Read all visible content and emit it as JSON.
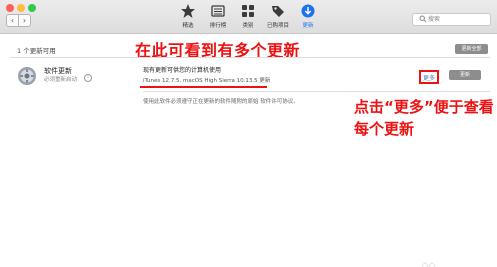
{
  "window": {
    "nav": {
      "back_icon": "chevron-left-icon",
      "forward_icon": "chevron-right-icon"
    },
    "traffic_colors": {
      "close": "#fc605c",
      "minimize": "#fdbc40",
      "zoom": "#34c84a"
    }
  },
  "toolbar": {
    "tabs": [
      {
        "label": "精选",
        "icon": "star-icon"
      },
      {
        "label": "排行榜",
        "icon": "chart-list-icon"
      },
      {
        "label": "类别",
        "icon": "category-grid-icon"
      },
      {
        "label": "已购项目",
        "icon": "purchased-tag-icon"
      },
      {
        "label": "更新",
        "icon": "updates-badge-icon"
      }
    ],
    "active_tab": "更新",
    "accent_color": "#1a73e8"
  },
  "search": {
    "placeholder": "搜索"
  },
  "header": {
    "available_count": "1 个更新可用",
    "update_all_label": "更新全部"
  },
  "annotations": {
    "top": "在此可看到有多个更新",
    "right": "点击“更多”便于查看每个更新",
    "color": "#ee1111"
  },
  "update_item": {
    "name": "软件更新",
    "subtitle": "必须重新启动",
    "description": "现有更新可供您的计算机使用",
    "items": "iTunes 12.7.5, macOS High Sierra 10.13.5 更新",
    "more_label": "更多",
    "update_label": "更新"
  },
  "terms": "使用此软件必须遵守正在更新的软件随附的原始 软件许可协议。"
}
